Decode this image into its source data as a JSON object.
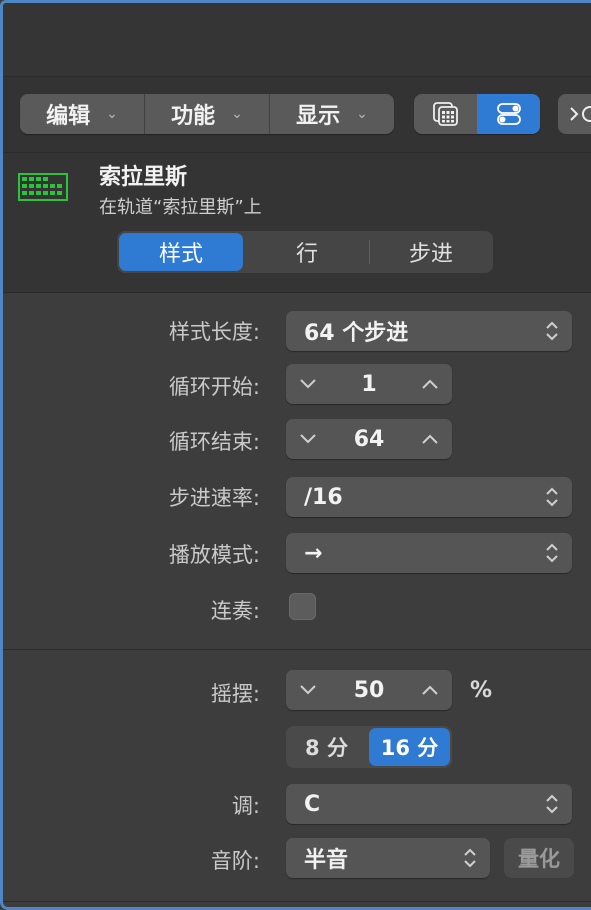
{
  "toolbar": {
    "menus": [
      {
        "label": "编辑"
      },
      {
        "label": "功能"
      },
      {
        "label": "显示"
      }
    ]
  },
  "track": {
    "name": "索拉里斯",
    "subtitle": "在轨道“索拉里斯”上"
  },
  "tabs": [
    {
      "label": "样式",
      "selected": true
    },
    {
      "label": "行",
      "selected": false
    },
    {
      "label": "步进",
      "selected": false
    }
  ],
  "settings": {
    "pattern_length": {
      "label": "样式长度:",
      "value": "64 个步进"
    },
    "loop_start": {
      "label": "循环开始:",
      "value": "1"
    },
    "loop_end": {
      "label": "循环结束:",
      "value": "64"
    },
    "step_rate": {
      "label": "步进速率:",
      "value": "/16"
    },
    "playback_mode": {
      "label": "播放模式:",
      "value": "→"
    },
    "legato": {
      "label": "连奏:",
      "checked": false
    },
    "swing": {
      "label": "摇摆:",
      "value": "50",
      "unit": "%"
    },
    "swing_resolution": {
      "options": [
        "8 分",
        "16 分"
      ],
      "selected": "16 分"
    },
    "key": {
      "label": "调:",
      "value": "C"
    },
    "scale": {
      "label": "音阶:",
      "value": "半音"
    },
    "quantize_label": "量化"
  },
  "colors": {
    "accent": "#2f7ad3",
    "track_icon": "#29c43a",
    "window_border": "#4f86c6"
  }
}
